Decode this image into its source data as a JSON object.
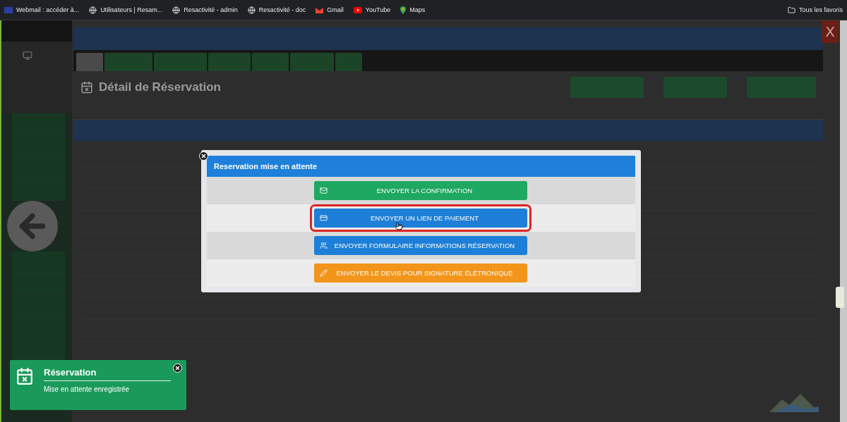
{
  "bookmarks": [
    {
      "label": "Webmail : accéder à...",
      "kind": "mail"
    },
    {
      "label": "Utilisateurs | Resam...",
      "kind": "globe"
    },
    {
      "label": "Resactivité - admin",
      "kind": "globe"
    },
    {
      "label": "Resactivité - doc",
      "kind": "globe"
    },
    {
      "label": "Gmail",
      "kind": "gmail"
    },
    {
      "label": "YouTube",
      "kind": "youtube"
    },
    {
      "label": "Maps",
      "kind": "maps"
    }
  ],
  "favorites": "Tous les favoris",
  "page": {
    "title": "Détail de Réservation",
    "close": "X",
    "tabs": [
      {
        "selected": true
      },
      {
        "selected": false
      },
      {
        "selected": false
      },
      {
        "selected": false
      },
      {
        "selected": false
      },
      {
        "selected": false
      },
      {
        "selected": false
      }
    ]
  },
  "modal": {
    "title": "Reservation mise en attente",
    "actions": [
      {
        "label": "ENVOYER LA CONFIRMATION",
        "kind": "mail",
        "color": "#1ea861",
        "highlighted": false
      },
      {
        "label": "ENVOYER UN LIEN DE PAIEMENT",
        "kind": "card",
        "color": "#1e7fd8",
        "highlighted": true
      },
      {
        "label": "ENVOYER FORMULAIRE INFORMATIONS RÉSERVATION",
        "kind": "users",
        "color": "#1e7fd8",
        "highlighted": false
      },
      {
        "label": "ENVOYER LE DEVIS POUR SIGNATURE ÉLÉTRONIQUE",
        "kind": "pencil",
        "color": "#f3951a",
        "highlighted": false
      }
    ]
  },
  "toast": {
    "title": "Réservation",
    "message": "Mise en attente enregistrée"
  }
}
